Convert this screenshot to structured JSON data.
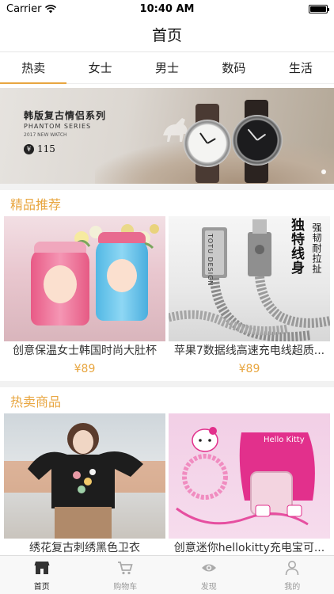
{
  "status_bar": {
    "carrier": "Carrier",
    "time": "10:40 AM"
  },
  "nav": {
    "title": "首页"
  },
  "categories": [
    {
      "label": "热卖",
      "active": true
    },
    {
      "label": "女士",
      "active": false
    },
    {
      "label": "男士",
      "active": false
    },
    {
      "label": "数码",
      "active": false
    },
    {
      "label": "生活",
      "active": false
    }
  ],
  "banner": {
    "title": "韩版复古情侣系列",
    "subtitle": "PHANTOM SERIES",
    "tagline": "2017 NEW WATCH",
    "currency_symbol": "¥",
    "price": "115",
    "page_count": 2,
    "current_page": 1
  },
  "sections": [
    {
      "title": "精品推荐",
      "products": [
        {
          "name": "创意保温女士韩国时尚大肚杯",
          "price": "¥89",
          "image": "thermos-cups"
        },
        {
          "name": "苹果7数据线高速充电线超质...",
          "price": "¥89",
          "image": "metal-cable",
          "image_text_main": "独特线身",
          "image_text_side": "强韧耐拉扯",
          "image_brand": "TOTU DESIGN"
        }
      ]
    },
    {
      "title": "热卖商品",
      "products": [
        {
          "name": "绣花复古刺绣黑色卫衣",
          "price": "",
          "image": "embroidered-sweater"
        },
        {
          "name": "创意迷你hellokitty充电宝可...",
          "price": "",
          "image": "hello-kitty-powerbank",
          "image_brand": "Hello Kitty"
        }
      ]
    }
  ],
  "tab_bar": [
    {
      "label": "首页",
      "icon": "home-store-icon",
      "active": true
    },
    {
      "label": "购物车",
      "icon": "cart-icon",
      "active": false
    },
    {
      "label": "发现",
      "icon": "eye-icon",
      "active": false
    },
    {
      "label": "我的",
      "icon": "person-icon",
      "active": false
    }
  ],
  "colors": {
    "accent": "#e8a640",
    "text": "#333333",
    "tab_inactive": "#999999"
  }
}
